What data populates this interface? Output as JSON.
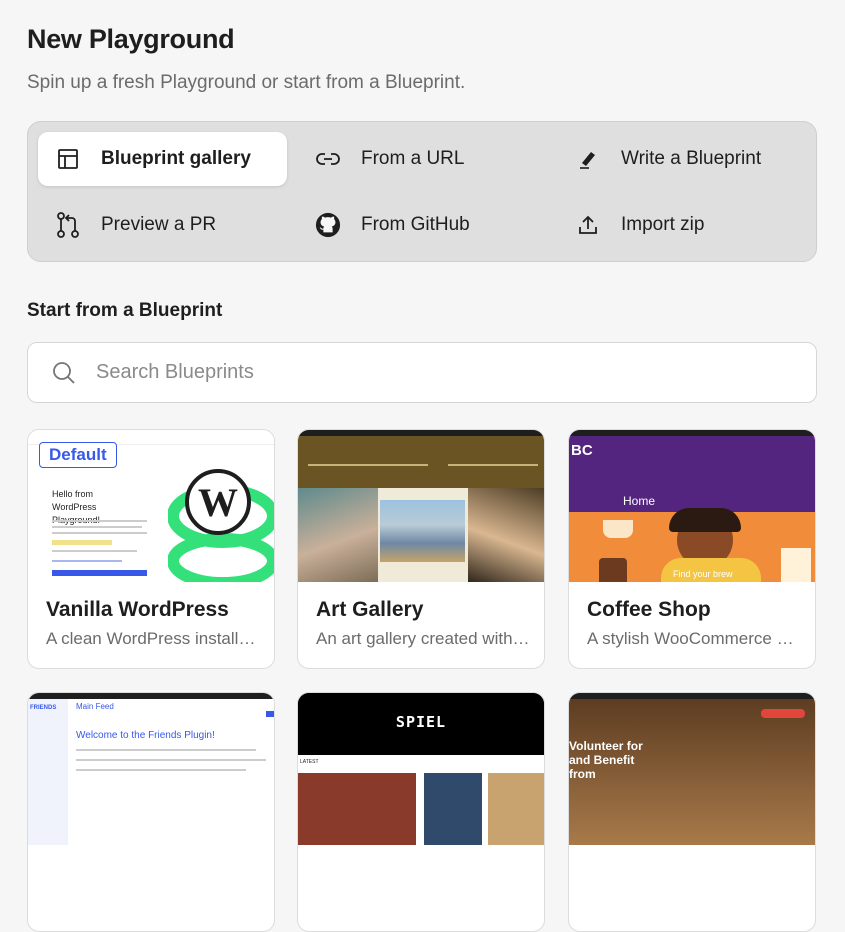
{
  "header": {
    "title": "New Playground",
    "subtitle": "Spin up a fresh Playground or start from a Blueprint."
  },
  "options": [
    {
      "label": "Blueprint gallery",
      "icon": "layout-icon",
      "active": true
    },
    {
      "label": "From a URL",
      "icon": "link-icon"
    },
    {
      "label": "Write a Blueprint",
      "icon": "pencil-icon"
    },
    {
      "label": "Preview a PR",
      "icon": "pull-request-icon"
    },
    {
      "label": "From GitHub",
      "icon": "github-icon"
    },
    {
      "label": "Import zip",
      "icon": "upload-icon"
    }
  ],
  "section": {
    "title": "Start from a Blueprint"
  },
  "search": {
    "placeholder": "Search Blueprints"
  },
  "cards": [
    {
      "title": "Vanilla WordPress",
      "description": "A clean WordPress installation",
      "badge": "Default",
      "thumb": {
        "hello": "Hello from WordPress Playground!"
      }
    },
    {
      "title": "Art Gallery",
      "description": "An art gallery created with WordPress"
    },
    {
      "title": "Coffee Shop",
      "description": "A stylish WooCommerce coffee shop",
      "thumb": {
        "heading": "Home",
        "caption": "Find your brew",
        "logo": "BC"
      }
    },
    {
      "title": "",
      "description": "",
      "thumb": {
        "heading": "Main Feed",
        "welcome": "Welcome to the Friends Plugin!",
        "sidebar": "FRIENDS"
      }
    },
    {
      "title": "",
      "description": "",
      "thumb": {
        "logo": "SPIEL",
        "tag": "LATEST"
      }
    },
    {
      "title": "",
      "description": "",
      "thumb": {
        "headline": "Volunteer for and Benefit from"
      }
    }
  ],
  "colors": {
    "accent": "#3858e9",
    "art_bg": "#6b5424",
    "coffee_purple": "#53257f",
    "coffee_orange": "#f18c3a",
    "spiel_bg": "#000000"
  }
}
